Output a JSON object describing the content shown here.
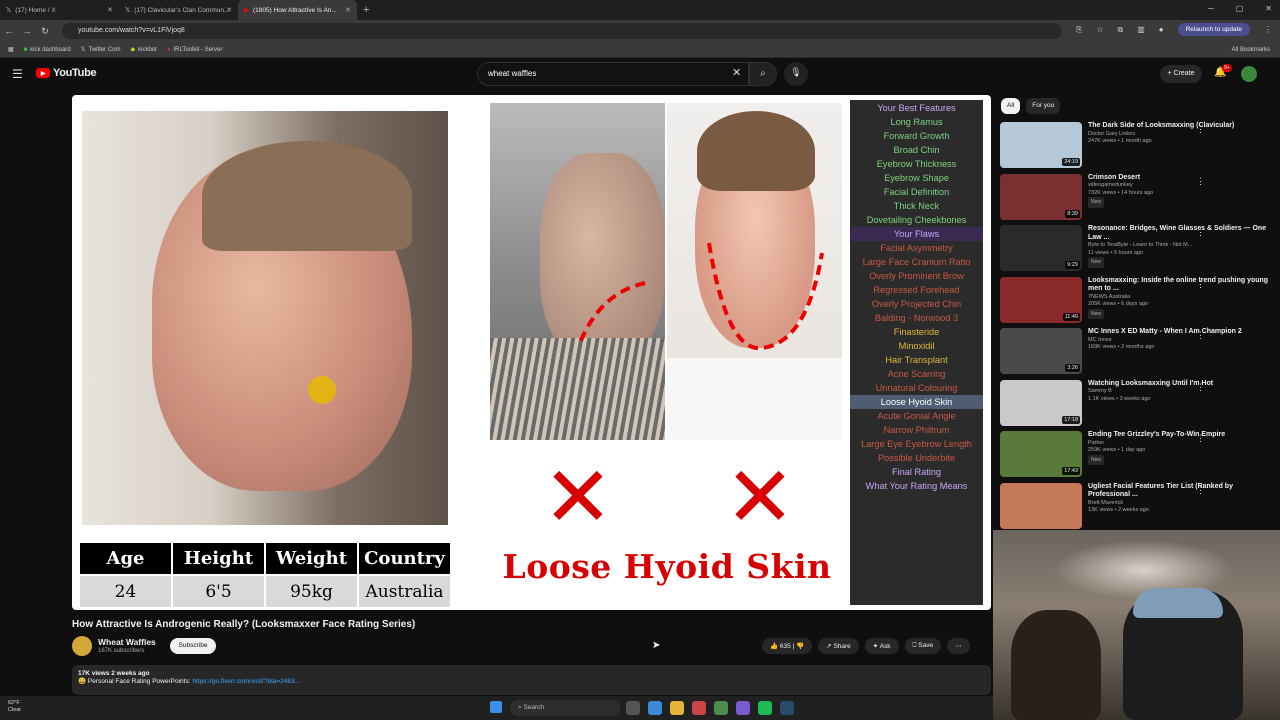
{
  "browser": {
    "tabs": [
      {
        "title": "(17) Home / X"
      },
      {
        "title": "(17) Clavicular's Clan Commun..."
      },
      {
        "title": "(1805) How Attractive Is An..."
      }
    ],
    "url": "youtube.com/watch?v=vL1FiVjoq8",
    "relaunch": "Relaunch to update",
    "bookmarks": [
      "kick dashboard",
      "Twitter Com",
      "kickbot",
      "IRLToolkit - Server"
    ],
    "all_bookmarks": "All Bookmarks"
  },
  "youtube": {
    "logo": "YouTube",
    "search_value": "wheat waffles",
    "create": "Create",
    "notif_count": "9+"
  },
  "video": {
    "attr_headers": [
      "Age",
      "Height",
      "Weight",
      "Country"
    ],
    "attr_values": [
      "24",
      "6'5",
      "95kg",
      "Australia"
    ],
    "caption": "Loose Hyoid Skin",
    "features": [
      {
        "t": "Your Best Features",
        "k": "hdr"
      },
      {
        "t": "Long Ramus",
        "k": "best"
      },
      {
        "t": "Forward Growth",
        "k": "best"
      },
      {
        "t": "Broad Chin",
        "k": "best"
      },
      {
        "t": "Eyebrow Thickness",
        "k": "best"
      },
      {
        "t": "Eyebrow Shape",
        "k": "best"
      },
      {
        "t": "Facial Definition",
        "k": "best"
      },
      {
        "t": "Thick Neck",
        "k": "best"
      },
      {
        "t": "Dovetailing Cheekbones",
        "k": "best"
      },
      {
        "t": "Your Flaws",
        "k": "hdr sec"
      },
      {
        "t": "Facial Asymmetry",
        "k": "flaw"
      },
      {
        "t": "Large Face Cranium Ratio",
        "k": "flaw"
      },
      {
        "t": "Overly Prominent Brow",
        "k": "flaw"
      },
      {
        "t": "Regressed Forehead",
        "k": "flaw"
      },
      {
        "t": "Overly Projected Chin",
        "k": "flaw"
      },
      {
        "t": "Balding - Norwood 3",
        "k": "flaw"
      },
      {
        "t": "Finasteride",
        "k": "gold"
      },
      {
        "t": "Minoxidil",
        "k": "gold"
      },
      {
        "t": "Hair Transplant",
        "k": "gold"
      },
      {
        "t": "Acne Scarring",
        "k": "flaw"
      },
      {
        "t": "Unnatural Colouring",
        "k": "flaw"
      },
      {
        "t": "Loose Hyoid Skin",
        "k": "sel"
      },
      {
        "t": "Acute Gonial Angle",
        "k": "flaw"
      },
      {
        "t": "Narrow Philtrum",
        "k": "flaw"
      },
      {
        "t": "Large Eye Eyebrow Length",
        "k": "flaw"
      },
      {
        "t": "Possible Underbite",
        "k": "flaw"
      },
      {
        "t": "Final Rating",
        "k": "hdr"
      },
      {
        "t": "What Your Rating Means",
        "k": "hdr"
      }
    ],
    "title": "How Attractive Is Androgenic Really? (Looksmaxxer Face Rating Series)",
    "channel": "Wheat Waffles",
    "subs": "167K subscribers",
    "subscribe": "Subscribe",
    "likes": "635",
    "share": "Share",
    "ask": "Ask",
    "save": "Save",
    "views_line": "17K views  2 weeks ago",
    "desc_text": "Personal Face Rating PowerPoints: ",
    "desc_link": "https://go.fiverr.com/visit/?bta=2483..."
  },
  "sidebar": {
    "filters": [
      "All",
      "For you"
    ],
    "recs": [
      {
        "title": "The Dark Side of Looksmaxxing (Clavicular)",
        "channel": "Doctor Gary Linkov",
        "meta": "247K views • 1 month ago",
        "dur": "24:19",
        "color": "#b5c8d8",
        "new": ""
      },
      {
        "title": "Crimson Desert",
        "channel": "videogamedunkey",
        "meta": "732K views • 14 hours ago",
        "dur": "8:39",
        "color": "#7a3030",
        "new": "New"
      },
      {
        "title": "Resonance: Bridges, Wine Glasses & Soldiers — One Law ...",
        "channel": "Byte to TeraByte - Learn to Think - Not M...",
        "meta": "11 views • 5 hours ago",
        "dur": "9:29",
        "color": "#2a2a2a",
        "new": "New"
      },
      {
        "title": "Looksmaxxing: Inside the online trend pushing young men to ...",
        "channel": "7NEWS Australia",
        "meta": "205K views • 6 days ago",
        "dur": "11:49",
        "color": "#8a2a2a",
        "new": "New"
      },
      {
        "title": "MC Innes X ED Matty - When I Am Champion 2",
        "channel": "MC Innes",
        "meta": "169K views • 2 months ago",
        "dur": "3:26",
        "color": "#4a4a4a",
        "new": ""
      },
      {
        "title": "Watching Looksmaxxing Until I'm Hot",
        "channel": "Sammy B",
        "meta": "1.1K views • 3 weeks ago",
        "dur": "17:18",
        "color": "#c9c9c9",
        "new": ""
      },
      {
        "title": "Ending Tee Grizzley's Pay-To-Win Empire",
        "channel": "Parker",
        "meta": "259K views • 1 day ago",
        "dur": "17:43",
        "color": "#5a7a3a",
        "new": "New"
      },
      {
        "title": "Ugliest Facial Features Tier List (Ranked by Professional ...",
        "channel": "Brett Maverick",
        "meta": "13K views • 2 weeks ago",
        "dur": "",
        "color": "#c47a5a",
        "new": ""
      }
    ]
  },
  "taskbar": {
    "weather_temp": "62°F",
    "weather_desc": "Clear",
    "search": "Search"
  }
}
